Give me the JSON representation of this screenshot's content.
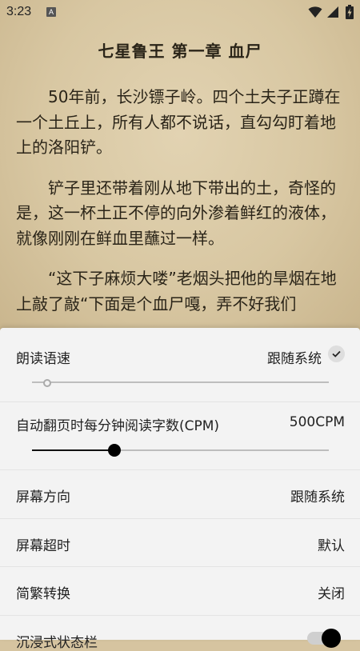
{
  "status": {
    "time": "3:23",
    "notification_letter": "A"
  },
  "reader": {
    "chapter_title": "七星鲁王 第一章 血尸",
    "paragraphs": [
      "50年前，长沙镖子岭。四个土夫子正蹲在一个土丘上，所有人都不说话，直勾勾盯着地上的洛阳铲。",
      "铲子里还带着刚从地下带出的土，奇怪的是，这一杯土正不停的向外渗着鲜红的液体，就像刚刚在鲜血里蘸过一样。",
      "“这下子麻烦大喽”老烟头把他的旱烟在地上敲了敲“下面是个血尸嘎，弄不好我们"
    ]
  },
  "settings": {
    "speech_rate": {
      "label": "朗读语速",
      "value": "跟随系统",
      "follow_system_checked": true,
      "level_fraction": 0.05
    },
    "auto_page_cpm": {
      "label": "自动翻页时每分钟阅读字数(CPM)",
      "value": "500CPM",
      "level_fraction": 0.28
    },
    "orientation": {
      "label": "屏幕方向",
      "value": "跟随系统"
    },
    "screen_timeout": {
      "label": "屏幕超时",
      "value": "默认"
    },
    "conversion": {
      "label": "简繁转换",
      "value": "关闭"
    },
    "immersive_status": {
      "label": "沉浸式状态栏",
      "enabled": true
    }
  }
}
